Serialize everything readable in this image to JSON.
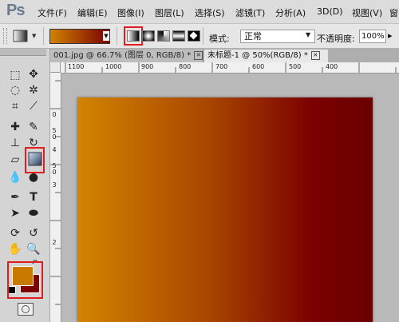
{
  "app": {
    "logo": "Ps"
  },
  "menu": [
    "文件(F)",
    "编辑(E)",
    "图像(I)",
    "图层(L)",
    "选择(S)",
    "滤镜(T)",
    "分析(A)",
    "3D(D)",
    "视图(V)",
    "窗"
  ],
  "options_bar": {
    "gradient": {
      "start_color": "#d18200",
      "end_color": "#7a0000"
    },
    "gradient_types": [
      "linear",
      "radial",
      "angle",
      "reflected",
      "diamond"
    ],
    "selected_gradient_type": "linear",
    "mode_label": "模式:",
    "mode_value": "正常",
    "opacity_label": "不透明度:",
    "opacity_value": "100%"
  },
  "tabs": [
    {
      "label": "001.jpg @ 66.7% (图层 0, RGB/8) *"
    },
    {
      "label": "未标题-1 @ 50%(RGB/8) *"
    }
  ],
  "ruler": {
    "horizontal": [
      "1100",
      "1000",
      "900",
      "800",
      "700",
      "600",
      "500",
      "400"
    ],
    "vertical": [
      "0",
      "5",
      "0",
      "4",
      "5",
      "0",
      "3",
      "2"
    ]
  },
  "colors": {
    "foreground": "#c77900",
    "background": "#7c0000",
    "highlight": "#e11d1d"
  },
  "canvas": {
    "gradient_start": "#d28400",
    "gradient_end": "#6a0000"
  }
}
